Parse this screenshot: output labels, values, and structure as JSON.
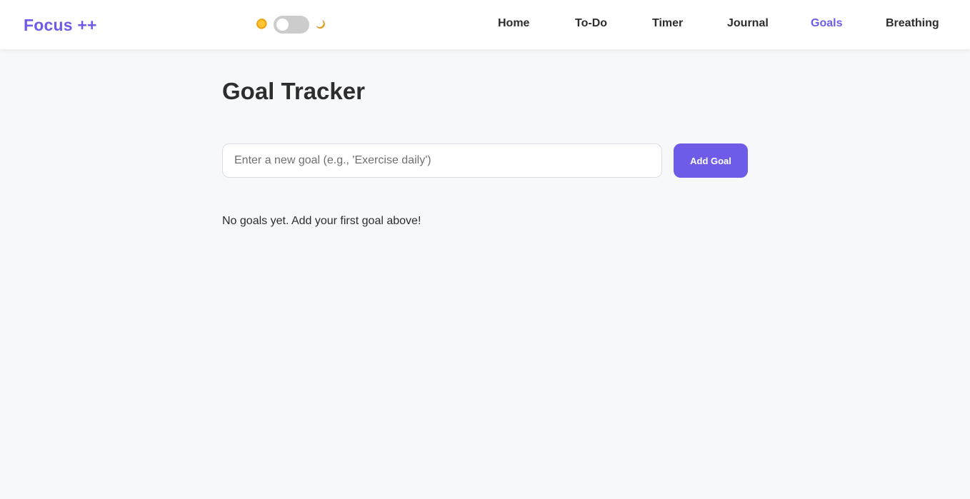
{
  "brand": {
    "logo_text": "Focus ++",
    "accent_color": "#6c5ce7"
  },
  "theme_toggle": {
    "light_icon": "sun-icon",
    "dark_icon": "moon-icon",
    "dark_mode_enabled": false
  },
  "nav": {
    "items": [
      {
        "label": "Home",
        "active": false
      },
      {
        "label": "To-Do",
        "active": false
      },
      {
        "label": "Timer",
        "active": false
      },
      {
        "label": "Journal",
        "active": false
      },
      {
        "label": "Goals",
        "active": true
      },
      {
        "label": "Breathing",
        "active": false
      }
    ]
  },
  "main": {
    "title": "Goal Tracker",
    "goal_input": {
      "value": "",
      "placeholder": "Enter a new goal (e.g., 'Exercise daily')"
    },
    "add_button_label": "Add Goal",
    "empty_message": "No goals yet. Add your first goal above!"
  }
}
